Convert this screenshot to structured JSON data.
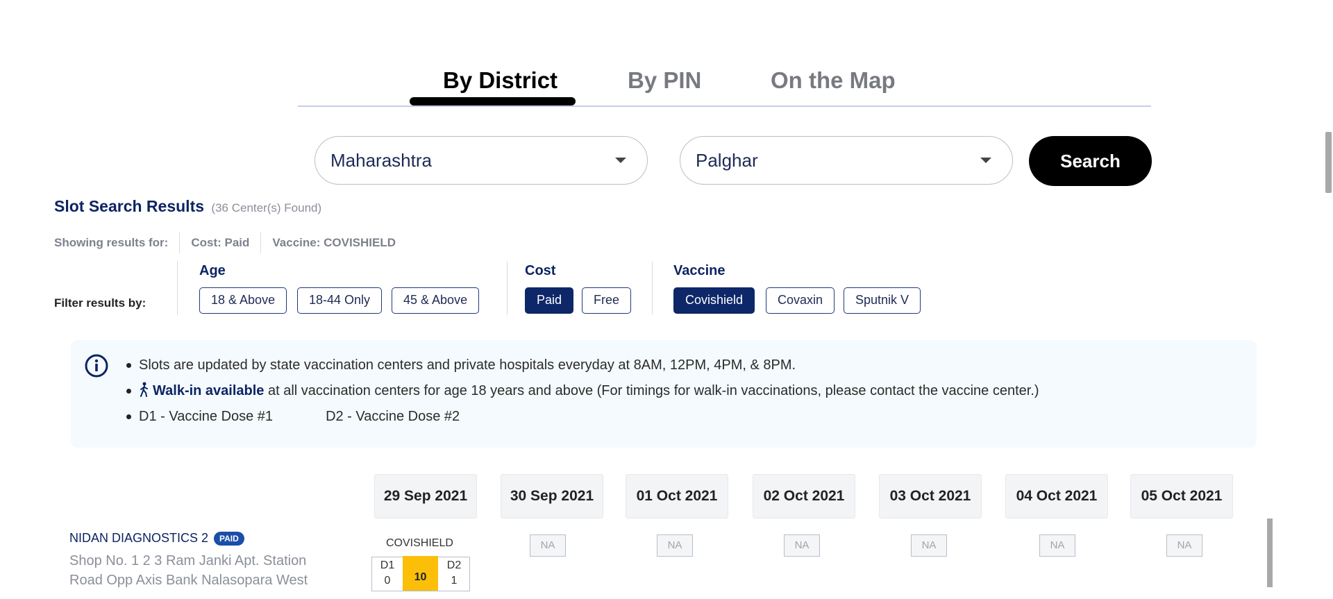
{
  "tabs": [
    {
      "label": "By District",
      "active": true
    },
    {
      "label": "By PIN",
      "active": false
    },
    {
      "label": "On the Map",
      "active": false
    }
  ],
  "search": {
    "state_value": "Maharashtra",
    "district_value": "Palghar",
    "button_label": "Search"
  },
  "results": {
    "title": "Slot Search Results",
    "count_text": "(36 Center(s) Found)",
    "showing_label": "Showing results for:",
    "showing_cost": "Cost: Paid",
    "showing_vaccine_prefix": "Vaccine: ",
    "showing_vaccine_value": "COVISHIELD"
  },
  "filters": {
    "label": "Filter results by:",
    "age": {
      "title": "Age",
      "options": [
        "18 & Above",
        "18-44 Only",
        "45 & Above"
      ]
    },
    "cost": {
      "title": "Cost",
      "options": [
        "Paid",
        "Free"
      ],
      "selected": "Paid"
    },
    "vaccine": {
      "title": "Vaccine",
      "options": [
        "Covishield",
        "Covaxin",
        "Sputnik V"
      ],
      "selected": "Covishield"
    }
  },
  "info": {
    "line1": "Slots are updated by state vaccination centers and private hospitals everyday at 8AM, 12PM, 4PM, & 8PM.",
    "walkin_bold": "Walk-in available",
    "walkin_rest": " at all vaccination centers for age 18 years and above (For timings for walk-in vaccinations, please contact the vaccine center.)",
    "dose1": "D1 - Vaccine Dose #1",
    "dose2": "D2 - Vaccine Dose #2"
  },
  "dates": [
    "29 Sep 2021",
    "30 Sep 2021",
    "01 Oct 2021",
    "02 Oct 2021",
    "03 Oct 2021",
    "04 Oct 2021",
    "05 Oct 2021"
  ],
  "center": {
    "name": "NIDAN DIAGNOSTICS 2",
    "badge": "PAID",
    "address": "Shop No. 1 2 3 Ram Janki Apt. Station Road Opp Axis Bank Nalasopara West",
    "vaccine": "COVISHIELD",
    "d1_label": "D1",
    "d1_value": "0",
    "total": "10",
    "d2_label": "D2",
    "d2_value": "1",
    "na_label": "NA"
  },
  "colors": {
    "accent": "#0d2768",
    "slot_highlight": "#fbbf0a",
    "info_bg": "#f4fafd"
  }
}
